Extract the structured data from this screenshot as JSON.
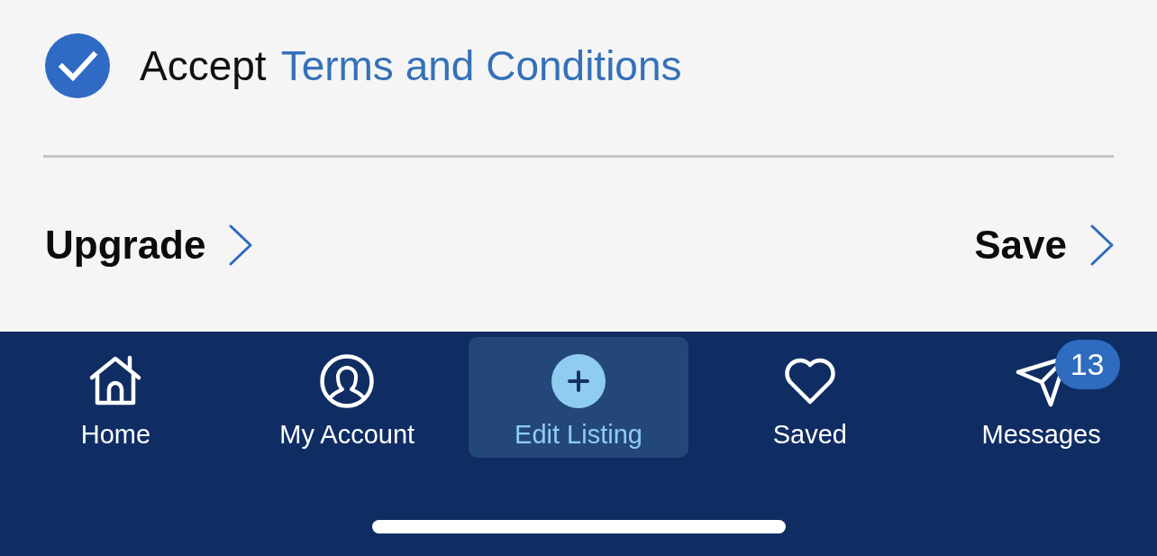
{
  "terms": {
    "checked": true,
    "prefix": "Accept",
    "link": "Terms and Conditions"
  },
  "actions": [
    {
      "label": "Upgrade"
    },
    {
      "label": "Save"
    }
  ],
  "tab_bar": {
    "tabs": [
      {
        "kind": "home",
        "label": "Home",
        "selected": false
      },
      {
        "kind": "account",
        "label": "My Account",
        "selected": false
      },
      {
        "kind": "add",
        "label": "Edit Listing",
        "selected": true
      },
      {
        "kind": "heart",
        "label": "Saved",
        "selected": false
      },
      {
        "kind": "send",
        "label": "Messages",
        "selected": false,
        "badge": "13"
      }
    ]
  }
}
